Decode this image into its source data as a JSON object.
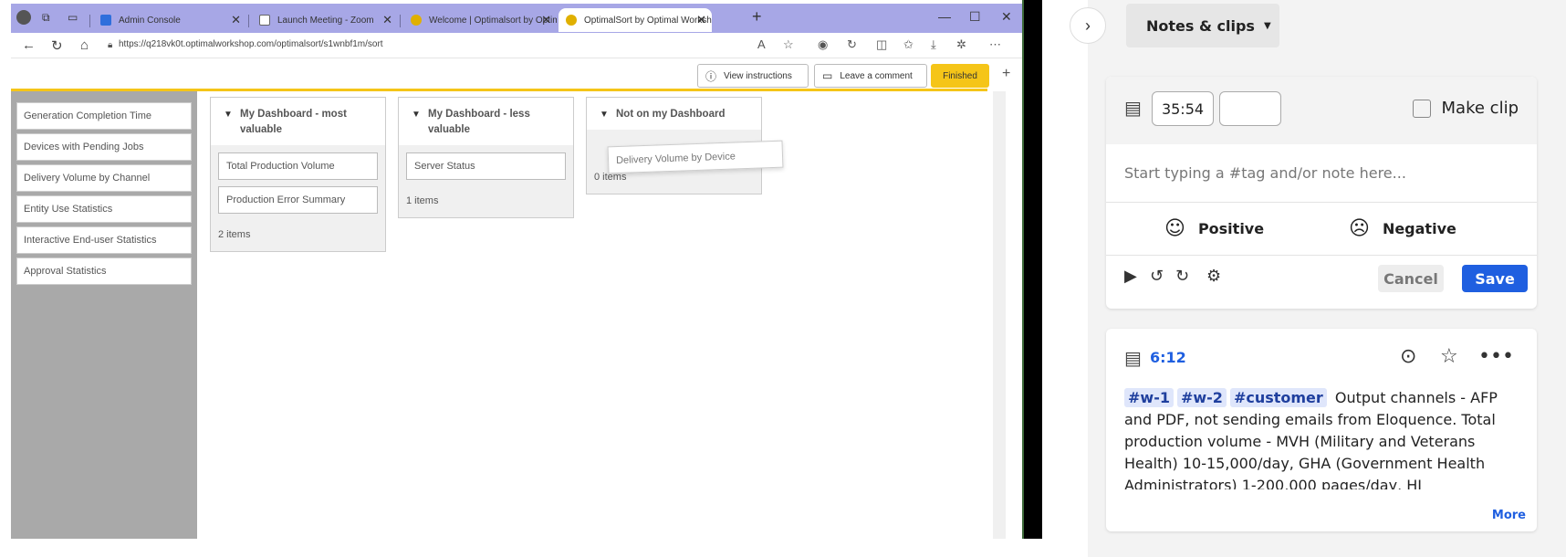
{
  "browser": {
    "tabs": [
      {
        "label": "Admin Console",
        "color": "#2f6fdc"
      },
      {
        "label": "Launch Meeting - Zoom",
        "color": "#888888"
      },
      {
        "label": "Welcome | Optimalsort by Optim",
        "color": "#e0b000"
      },
      {
        "label": "OptimalSort by Optimal Worksho",
        "color": "#e0b000"
      }
    ],
    "new_tab": "+",
    "url": "https://q218vk0t.optimalworkshop.com/optimalsort/s1wnbf1m/sort"
  },
  "toolbar": {
    "view_instructions": "View instructions",
    "leave_comment": "Leave a comment",
    "finished": "Finished",
    "add": "+"
  },
  "unsorted_cards": [
    "Generation Completion Time",
    "Devices with Pending Jobs",
    "Delivery Volume by Channel",
    "Entity Use Statistics",
    "Interactive End-user Statistics",
    "Approval Statistics"
  ],
  "groups": [
    {
      "title": "My Dashboard - most valuable",
      "cards": [
        "Total Production Volume",
        "Production Error Summary"
      ],
      "count": "2 items"
    },
    {
      "title": "My Dashboard - less valuable",
      "cards": [
        "Server Status"
      ],
      "count": "1 items"
    },
    {
      "title": "Not on my Dashboard",
      "cards": [],
      "count": "0 items"
    }
  ],
  "dragging_card": "Delivery Volume by Device",
  "notes": {
    "menu_label": "Notes & clips",
    "timestamp": "35:54",
    "make_clip": "Make clip",
    "placeholder": "Start typing a #tag and/or note here...",
    "positive": "Positive",
    "negative": "Negative",
    "cancel": "Cancel",
    "save": "Save",
    "clip": {
      "time": "6:12",
      "tags": [
        "#w-1",
        "#w-2",
        "#customer"
      ],
      "text": "Output channels - AFP and PDF, not sending emails from Eloquence. Total production volume - MVH (Military and Veterans Health) 10-15,000/day, GHA (Government Health Administrators) 1-200,000 pages/day, HI (Commercial Health Insurance)",
      "more": "More"
    }
  },
  "colors": {
    "accent": "#1f5fe0",
    "finished": "#f5c518",
    "tabbar": "#a7a7e6"
  }
}
